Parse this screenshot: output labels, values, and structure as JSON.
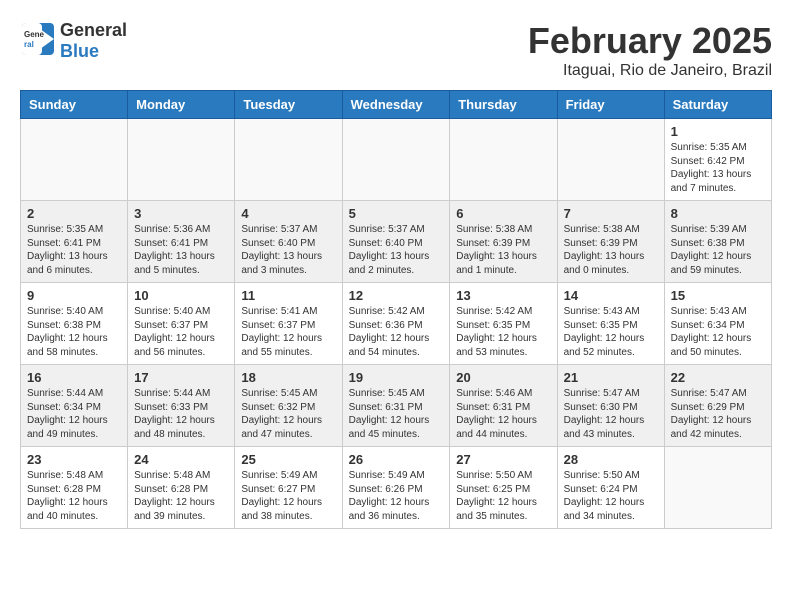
{
  "header": {
    "logo_general": "General",
    "logo_blue": "Blue",
    "month_title": "February 2025",
    "subtitle": "Itaguai, Rio de Janeiro, Brazil"
  },
  "days_of_week": [
    "Sunday",
    "Monday",
    "Tuesday",
    "Wednesday",
    "Thursday",
    "Friday",
    "Saturday"
  ],
  "weeks": [
    [
      {
        "day": "",
        "info": ""
      },
      {
        "day": "",
        "info": ""
      },
      {
        "day": "",
        "info": ""
      },
      {
        "day": "",
        "info": ""
      },
      {
        "day": "",
        "info": ""
      },
      {
        "day": "",
        "info": ""
      },
      {
        "day": "1",
        "info": "Sunrise: 5:35 AM\nSunset: 6:42 PM\nDaylight: 13 hours and 7 minutes."
      }
    ],
    [
      {
        "day": "2",
        "info": "Sunrise: 5:35 AM\nSunset: 6:41 PM\nDaylight: 13 hours and 6 minutes."
      },
      {
        "day": "3",
        "info": "Sunrise: 5:36 AM\nSunset: 6:41 PM\nDaylight: 13 hours and 5 minutes."
      },
      {
        "day": "4",
        "info": "Sunrise: 5:37 AM\nSunset: 6:40 PM\nDaylight: 13 hours and 3 minutes."
      },
      {
        "day": "5",
        "info": "Sunrise: 5:37 AM\nSunset: 6:40 PM\nDaylight: 13 hours and 2 minutes."
      },
      {
        "day": "6",
        "info": "Sunrise: 5:38 AM\nSunset: 6:39 PM\nDaylight: 13 hours and 1 minute."
      },
      {
        "day": "7",
        "info": "Sunrise: 5:38 AM\nSunset: 6:39 PM\nDaylight: 13 hours and 0 minutes."
      },
      {
        "day": "8",
        "info": "Sunrise: 5:39 AM\nSunset: 6:38 PM\nDaylight: 12 hours and 59 minutes."
      }
    ],
    [
      {
        "day": "9",
        "info": "Sunrise: 5:40 AM\nSunset: 6:38 PM\nDaylight: 12 hours and 58 minutes."
      },
      {
        "day": "10",
        "info": "Sunrise: 5:40 AM\nSunset: 6:37 PM\nDaylight: 12 hours and 56 minutes."
      },
      {
        "day": "11",
        "info": "Sunrise: 5:41 AM\nSunset: 6:37 PM\nDaylight: 12 hours and 55 minutes."
      },
      {
        "day": "12",
        "info": "Sunrise: 5:42 AM\nSunset: 6:36 PM\nDaylight: 12 hours and 54 minutes."
      },
      {
        "day": "13",
        "info": "Sunrise: 5:42 AM\nSunset: 6:35 PM\nDaylight: 12 hours and 53 minutes."
      },
      {
        "day": "14",
        "info": "Sunrise: 5:43 AM\nSunset: 6:35 PM\nDaylight: 12 hours and 52 minutes."
      },
      {
        "day": "15",
        "info": "Sunrise: 5:43 AM\nSunset: 6:34 PM\nDaylight: 12 hours and 50 minutes."
      }
    ],
    [
      {
        "day": "16",
        "info": "Sunrise: 5:44 AM\nSunset: 6:34 PM\nDaylight: 12 hours and 49 minutes."
      },
      {
        "day": "17",
        "info": "Sunrise: 5:44 AM\nSunset: 6:33 PM\nDaylight: 12 hours and 48 minutes."
      },
      {
        "day": "18",
        "info": "Sunrise: 5:45 AM\nSunset: 6:32 PM\nDaylight: 12 hours and 47 minutes."
      },
      {
        "day": "19",
        "info": "Sunrise: 5:45 AM\nSunset: 6:31 PM\nDaylight: 12 hours and 45 minutes."
      },
      {
        "day": "20",
        "info": "Sunrise: 5:46 AM\nSunset: 6:31 PM\nDaylight: 12 hours and 44 minutes."
      },
      {
        "day": "21",
        "info": "Sunrise: 5:47 AM\nSunset: 6:30 PM\nDaylight: 12 hours and 43 minutes."
      },
      {
        "day": "22",
        "info": "Sunrise: 5:47 AM\nSunset: 6:29 PM\nDaylight: 12 hours and 42 minutes."
      }
    ],
    [
      {
        "day": "23",
        "info": "Sunrise: 5:48 AM\nSunset: 6:28 PM\nDaylight: 12 hours and 40 minutes."
      },
      {
        "day": "24",
        "info": "Sunrise: 5:48 AM\nSunset: 6:28 PM\nDaylight: 12 hours and 39 minutes."
      },
      {
        "day": "25",
        "info": "Sunrise: 5:49 AM\nSunset: 6:27 PM\nDaylight: 12 hours and 38 minutes."
      },
      {
        "day": "26",
        "info": "Sunrise: 5:49 AM\nSunset: 6:26 PM\nDaylight: 12 hours and 36 minutes."
      },
      {
        "day": "27",
        "info": "Sunrise: 5:50 AM\nSunset: 6:25 PM\nDaylight: 12 hours and 35 minutes."
      },
      {
        "day": "28",
        "info": "Sunrise: 5:50 AM\nSunset: 6:24 PM\nDaylight: 12 hours and 34 minutes."
      },
      {
        "day": "",
        "info": ""
      }
    ]
  ]
}
